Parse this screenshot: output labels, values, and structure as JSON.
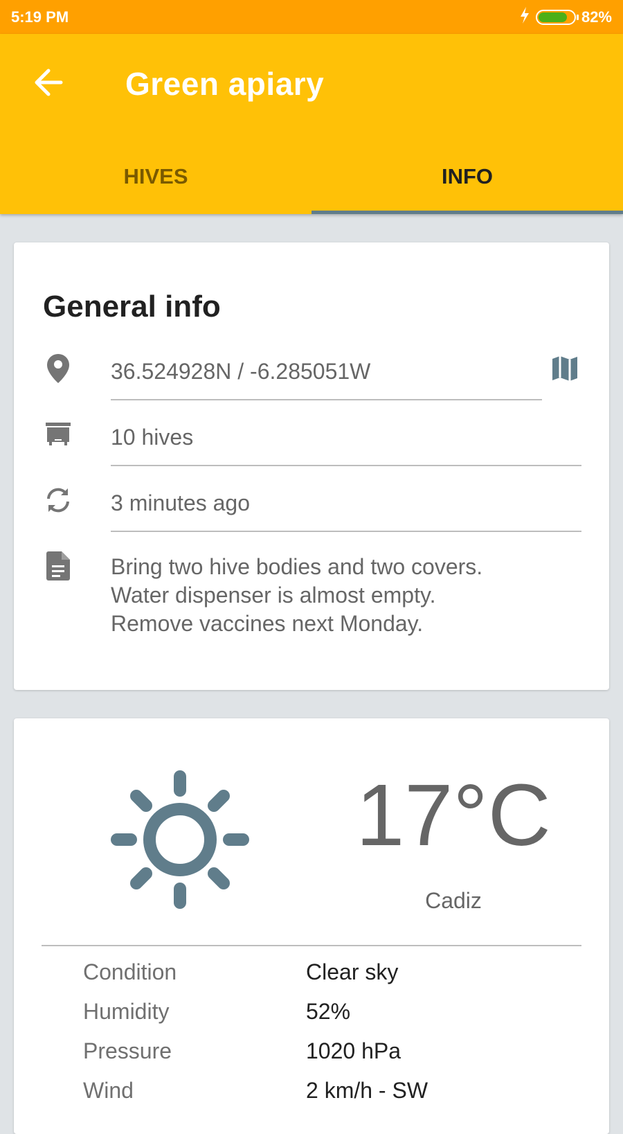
{
  "status_bar": {
    "time": "5:19 PM",
    "battery_percent": "82%",
    "battery_level": 0.82
  },
  "app_bar": {
    "title": "Green apiary",
    "tabs": [
      {
        "label": "HIVES",
        "active": false
      },
      {
        "label": "INFO",
        "active": true
      }
    ]
  },
  "general_info": {
    "title": "General info",
    "location": "36.524928N / -6.285051W",
    "hives": "10 hives",
    "last_sync": "3 minutes ago",
    "notes": [
      "Bring two hive bodies and two covers.",
      "Water dispenser is almost empty.",
      "Remove vaccines next Monday."
    ]
  },
  "weather": {
    "temperature": "17°C",
    "city": "Cadiz",
    "details": [
      {
        "label": "Condition",
        "value": "Clear sky"
      },
      {
        "label": "Humidity",
        "value": "52%"
      },
      {
        "label": "Pressure",
        "value": "1020 hPa"
      },
      {
        "label": "Wind",
        "value": "2 km/h - SW"
      }
    ]
  },
  "colors": {
    "status_bar": "#FFA000",
    "app_bar": "#FFC107",
    "tab_indicator": "#607D8B",
    "icon_gray": "#757575",
    "sun_icon": "#607D8B",
    "background": "#DFE3E6"
  }
}
